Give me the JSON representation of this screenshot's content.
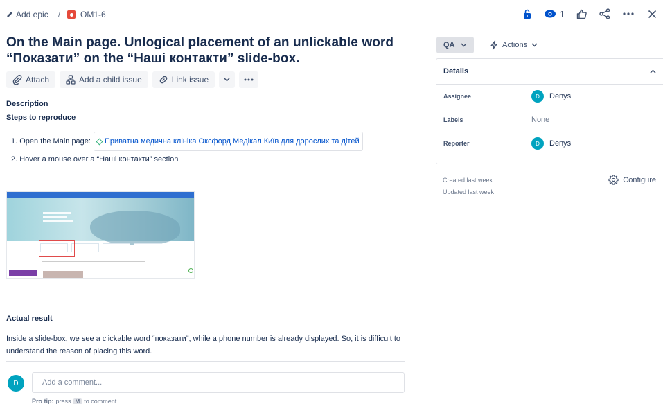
{
  "topbar": {
    "add_epic_label": "Add epic",
    "separator": "/",
    "issue_key": "OM1-6",
    "watchers_count": "1",
    "icons": [
      "lock-icon",
      "eye-icon",
      "like-icon",
      "share-icon",
      "more-icon",
      "close-icon"
    ],
    "accent_color": "#0052cc",
    "lock_color": "#0052cc"
  },
  "issue": {
    "title": "On the Main page. Unlogical placement of an unlickable word “Показати” on the “Наші контакти” slide-box."
  },
  "toolbar": {
    "attach_label": "Attach",
    "child_issue_label": "Add a child issue",
    "link_issue_label": "Link issue"
  },
  "description": {
    "heading": "Description",
    "steps_heading": "Steps to reproduce",
    "step1_prefix": "1. Open the Main page:",
    "step1_link": "Приватна медична клініка Оксфорд Медікал Київ для дорослих та дітей",
    "step2": "2. Hover a mouse over a “Наші контакти” section",
    "actual_heading": "Actual result",
    "actual_text": "Inside a slide-box, we see a clickable word “показати”, while a phone number is already displayed. So, it is difficult to understand the reason of placing this word."
  },
  "comment": {
    "avatar_initial": "D",
    "placeholder": "Add a comment...",
    "protip_bold": "Pro tip:",
    "protip_text1": "press",
    "protip_key": "M",
    "protip_text2": "to comment"
  },
  "sidebar": {
    "status_label": "QA",
    "actions_label": "Actions",
    "details_heading": "Details",
    "assignee_label": "Assignee",
    "assignee_name": "Denys",
    "assignee_initial": "D",
    "labels_label": "Labels",
    "labels_value": "None",
    "reporter_label": "Reporter",
    "reporter_name": "Denys",
    "reporter_initial": "D",
    "created": "Created last week",
    "updated": "Updated last week",
    "configure_label": "Configure"
  }
}
